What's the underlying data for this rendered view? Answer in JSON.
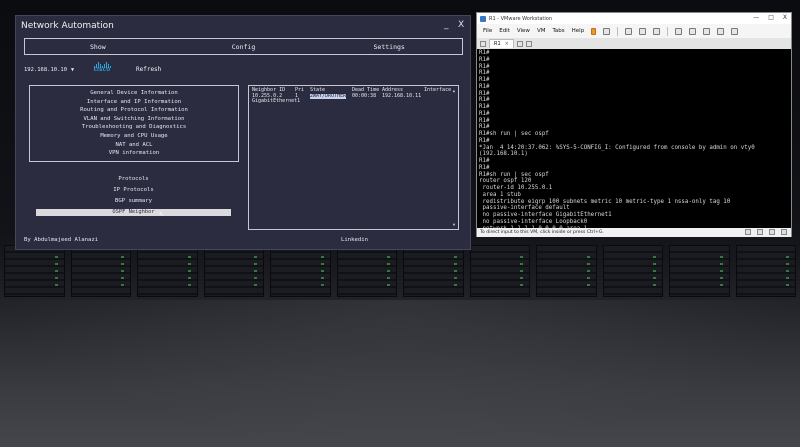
{
  "app": {
    "title": "Network Automation",
    "minimize": "_",
    "close": "X",
    "tabs": [
      "Show",
      "Config",
      "Settings"
    ],
    "device": "192.168.10.10",
    "device_caret": "▼",
    "logo_text": "CISCO",
    "refresh": "Refresh",
    "menu": [
      "General Device Information",
      "Interface and IP Information",
      "Routing and Protocol Information",
      "VLAN and Switching Information",
      "Troubleshooting and Diagnostics",
      "Memory and CPU Usage",
      "NAT and ACL",
      "VPN information"
    ],
    "menu2": [
      "Protocols",
      "IP Protocols",
      "BGP summary"
    ],
    "selected_item": "OSPF Neighbor",
    "output": {
      "headers": [
        "Neighbor ID",
        "Pri",
        "State",
        "Dead Time",
        "Address",
        "Interface"
      ],
      "row": [
        "10.255.0.2",
        "1",
        "2WAY/DROTHER",
        "00:00:38",
        "192.168.10.11"
      ],
      "row_interface": "GigabitEthernet1"
    },
    "author": "By Abdulmajeed Alanazi",
    "link": "Linkedin"
  },
  "vmware": {
    "title": "R1 - VMware Workstation",
    "win_controls": [
      "—",
      "□",
      "X"
    ],
    "menu": [
      "File",
      "Edit",
      "View",
      "VM",
      "Tabs",
      "Help"
    ],
    "tab_label": "R1",
    "tab_close": "×",
    "console_lines": [
      "R1#",
      "R1#",
      "R1#",
      "R1#",
      "R1#",
      "R1#",
      "R1#",
      "R1#",
      "R1#",
      "R1#",
      "R1#",
      "R1#",
      "R1#sh run | sec ospf",
      "R1#",
      "*Jan  4 14:20:37.062: %SYS-5-CONFIG_I: Configured from console by admin on vty0",
      "(192.168.10.1)",
      "R1#",
      "R1#",
      "R1#sh run | sec ospf",
      "router ospf 120",
      " router-id 10.255.0.1",
      " area 1 stub",
      " redistribute eigrp 100 subnets metric 10 metric-type 1 nssa-only tag 10",
      " passive-interface default",
      " no passive-interface GigabitEthernet1",
      " no passive-interface Loopback0",
      " network 1.1.1.1 0.0.0.0 area 1",
      " network 192.168.10.0 0.0.0.255 area 1",
      "R1#",
      "R1#",
      "R1#",
      "R1#_"
    ],
    "status": "To direct input to this VM, click inside or press Ctrl+G."
  }
}
